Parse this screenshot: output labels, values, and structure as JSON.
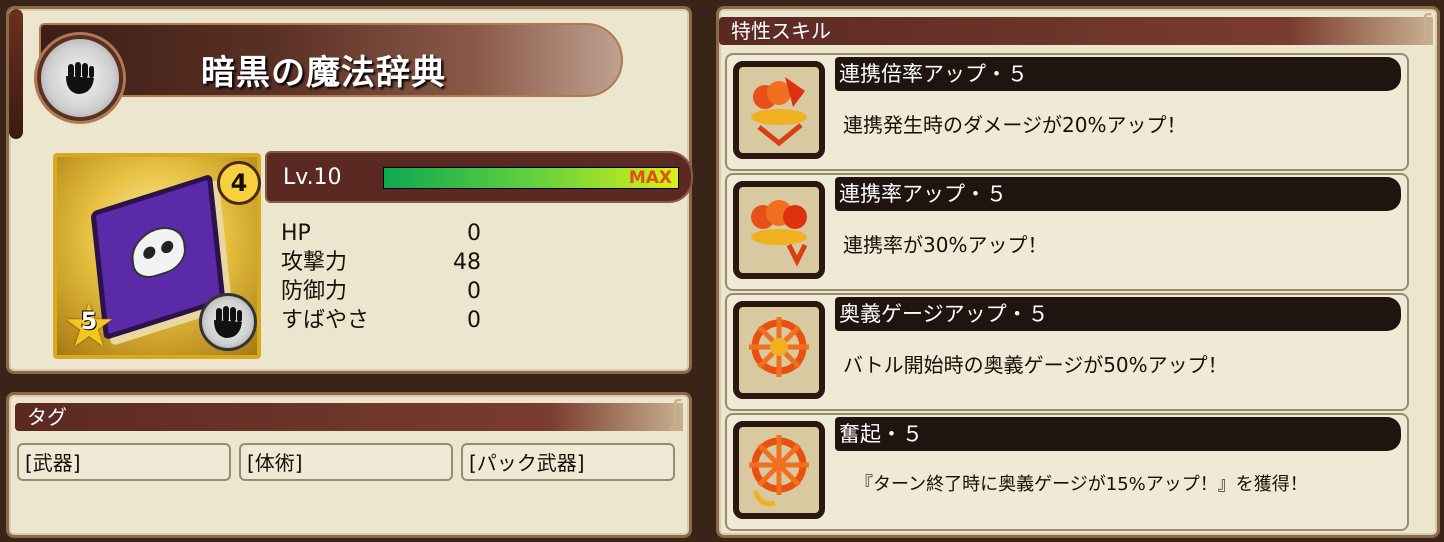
{
  "item": {
    "name": "暗黒の魔法辞典",
    "rarity_stars": "5",
    "limit_break": "4",
    "level_text": "Lv.10",
    "exp_progress": 1.0,
    "max_label": "MAX",
    "type_icon": "fist-icon"
  },
  "stats": [
    {
      "label": "HP",
      "value": "0"
    },
    {
      "label": "攻撃力",
      "value": "48"
    },
    {
      "label": "防御力",
      "value": "0"
    },
    {
      "label": "すばやさ",
      "value": "0"
    }
  ],
  "tags": {
    "header": "タグ",
    "items": [
      "[武器]",
      "[体術]",
      "[パック武器]"
    ]
  },
  "skills": {
    "header": "特性スキル",
    "items": [
      {
        "name": "連携倍率アップ・５",
        "desc": "連携発生時のダメージが20%アップ！",
        "icon": "combo-multiplier-icon"
      },
      {
        "name": "連携率アップ・５",
        "desc": "連携率が30%アップ！",
        "icon": "combo-rate-icon"
      },
      {
        "name": "奥義ゲージアップ・５",
        "desc": "バトル開始時の奥義ゲージが50%アップ！",
        "icon": "gauge-up-icon"
      },
      {
        "name": "奮起・５",
        "desc": "『ターン終了時に奥義ゲージが15%アップ！』を獲得！",
        "icon": "rally-icon"
      }
    ]
  },
  "colors": {
    "panel_bg": "#ece6cf",
    "header_brown": "#5a2a22",
    "exp_green": "#10a850",
    "max_orange": "#e05010"
  }
}
